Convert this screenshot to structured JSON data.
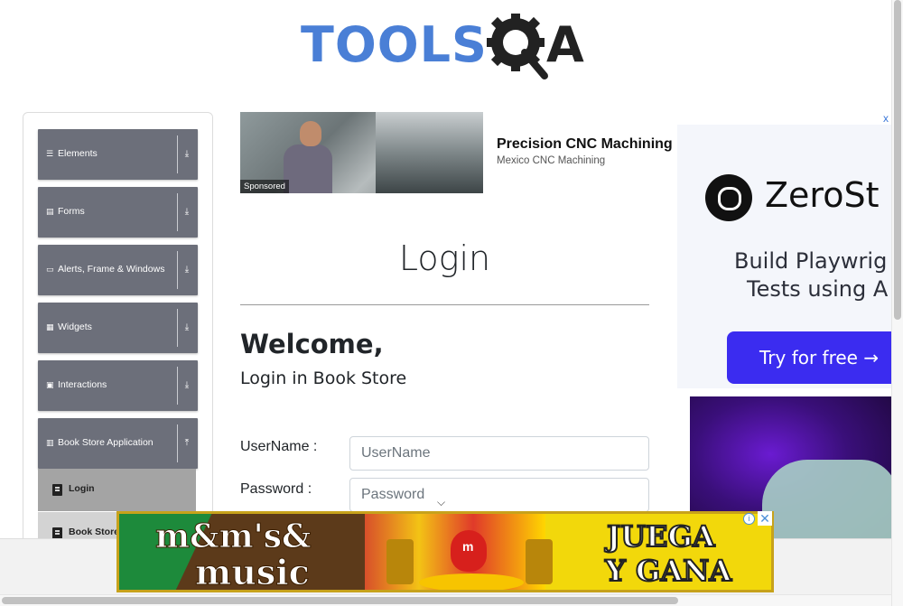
{
  "header": {
    "logo_text": "TOOLS",
    "logo_text_right": "A"
  },
  "sidebar": {
    "groups": [
      {
        "label": "Elements",
        "icon": "list-icon",
        "arrow": "download-icon"
      },
      {
        "label": "Forms",
        "icon": "form-icon",
        "arrow": "download-icon"
      },
      {
        "label": "Alerts, Frame & Windows",
        "icon": "window-icon",
        "arrow": "download-icon"
      },
      {
        "label": "Widgets",
        "icon": "grid-icon",
        "arrow": "download-icon"
      },
      {
        "label": "Interactions",
        "icon": "interaction-icon",
        "arrow": "download-icon"
      },
      {
        "label": "Book Store Application",
        "icon": "library-icon",
        "arrow": "upload-icon"
      }
    ],
    "subitems": [
      {
        "label": "Login",
        "active": true
      },
      {
        "label": "Book Store",
        "active": false
      }
    ]
  },
  "ad_top": {
    "sponsored": "Sponsored",
    "title": "Precision CNC Machining",
    "subtitle": "Mexico CNC Machining"
  },
  "main": {
    "title": "Login",
    "welcome": "Welcome,",
    "welcome_sub": "Login in Book Store",
    "username_label": "UserName :",
    "username_placeholder": "UserName",
    "password_label": "Password :",
    "password_placeholder": "Password"
  },
  "ad_right": {
    "brand": "ZeroSt",
    "tagline_1": "Build Playwrig",
    "tagline_2": "Tests using A",
    "cta": "Try for free →",
    "close": "x"
  },
  "banner": {
    "brand": "m&m's&",
    "music": "music",
    "juega": "JUEGA",
    "ygana": "Y GANA",
    "info": "i",
    "close": "✕"
  },
  "colors": {
    "sidebar_group_bg": "#6c6f7a",
    "subitem_bg": "#d3d3d3",
    "subitem_active_bg": "#a4a4a4",
    "logo_blue": "#4a7fd6",
    "cta_blue": "#3b2cf0"
  }
}
